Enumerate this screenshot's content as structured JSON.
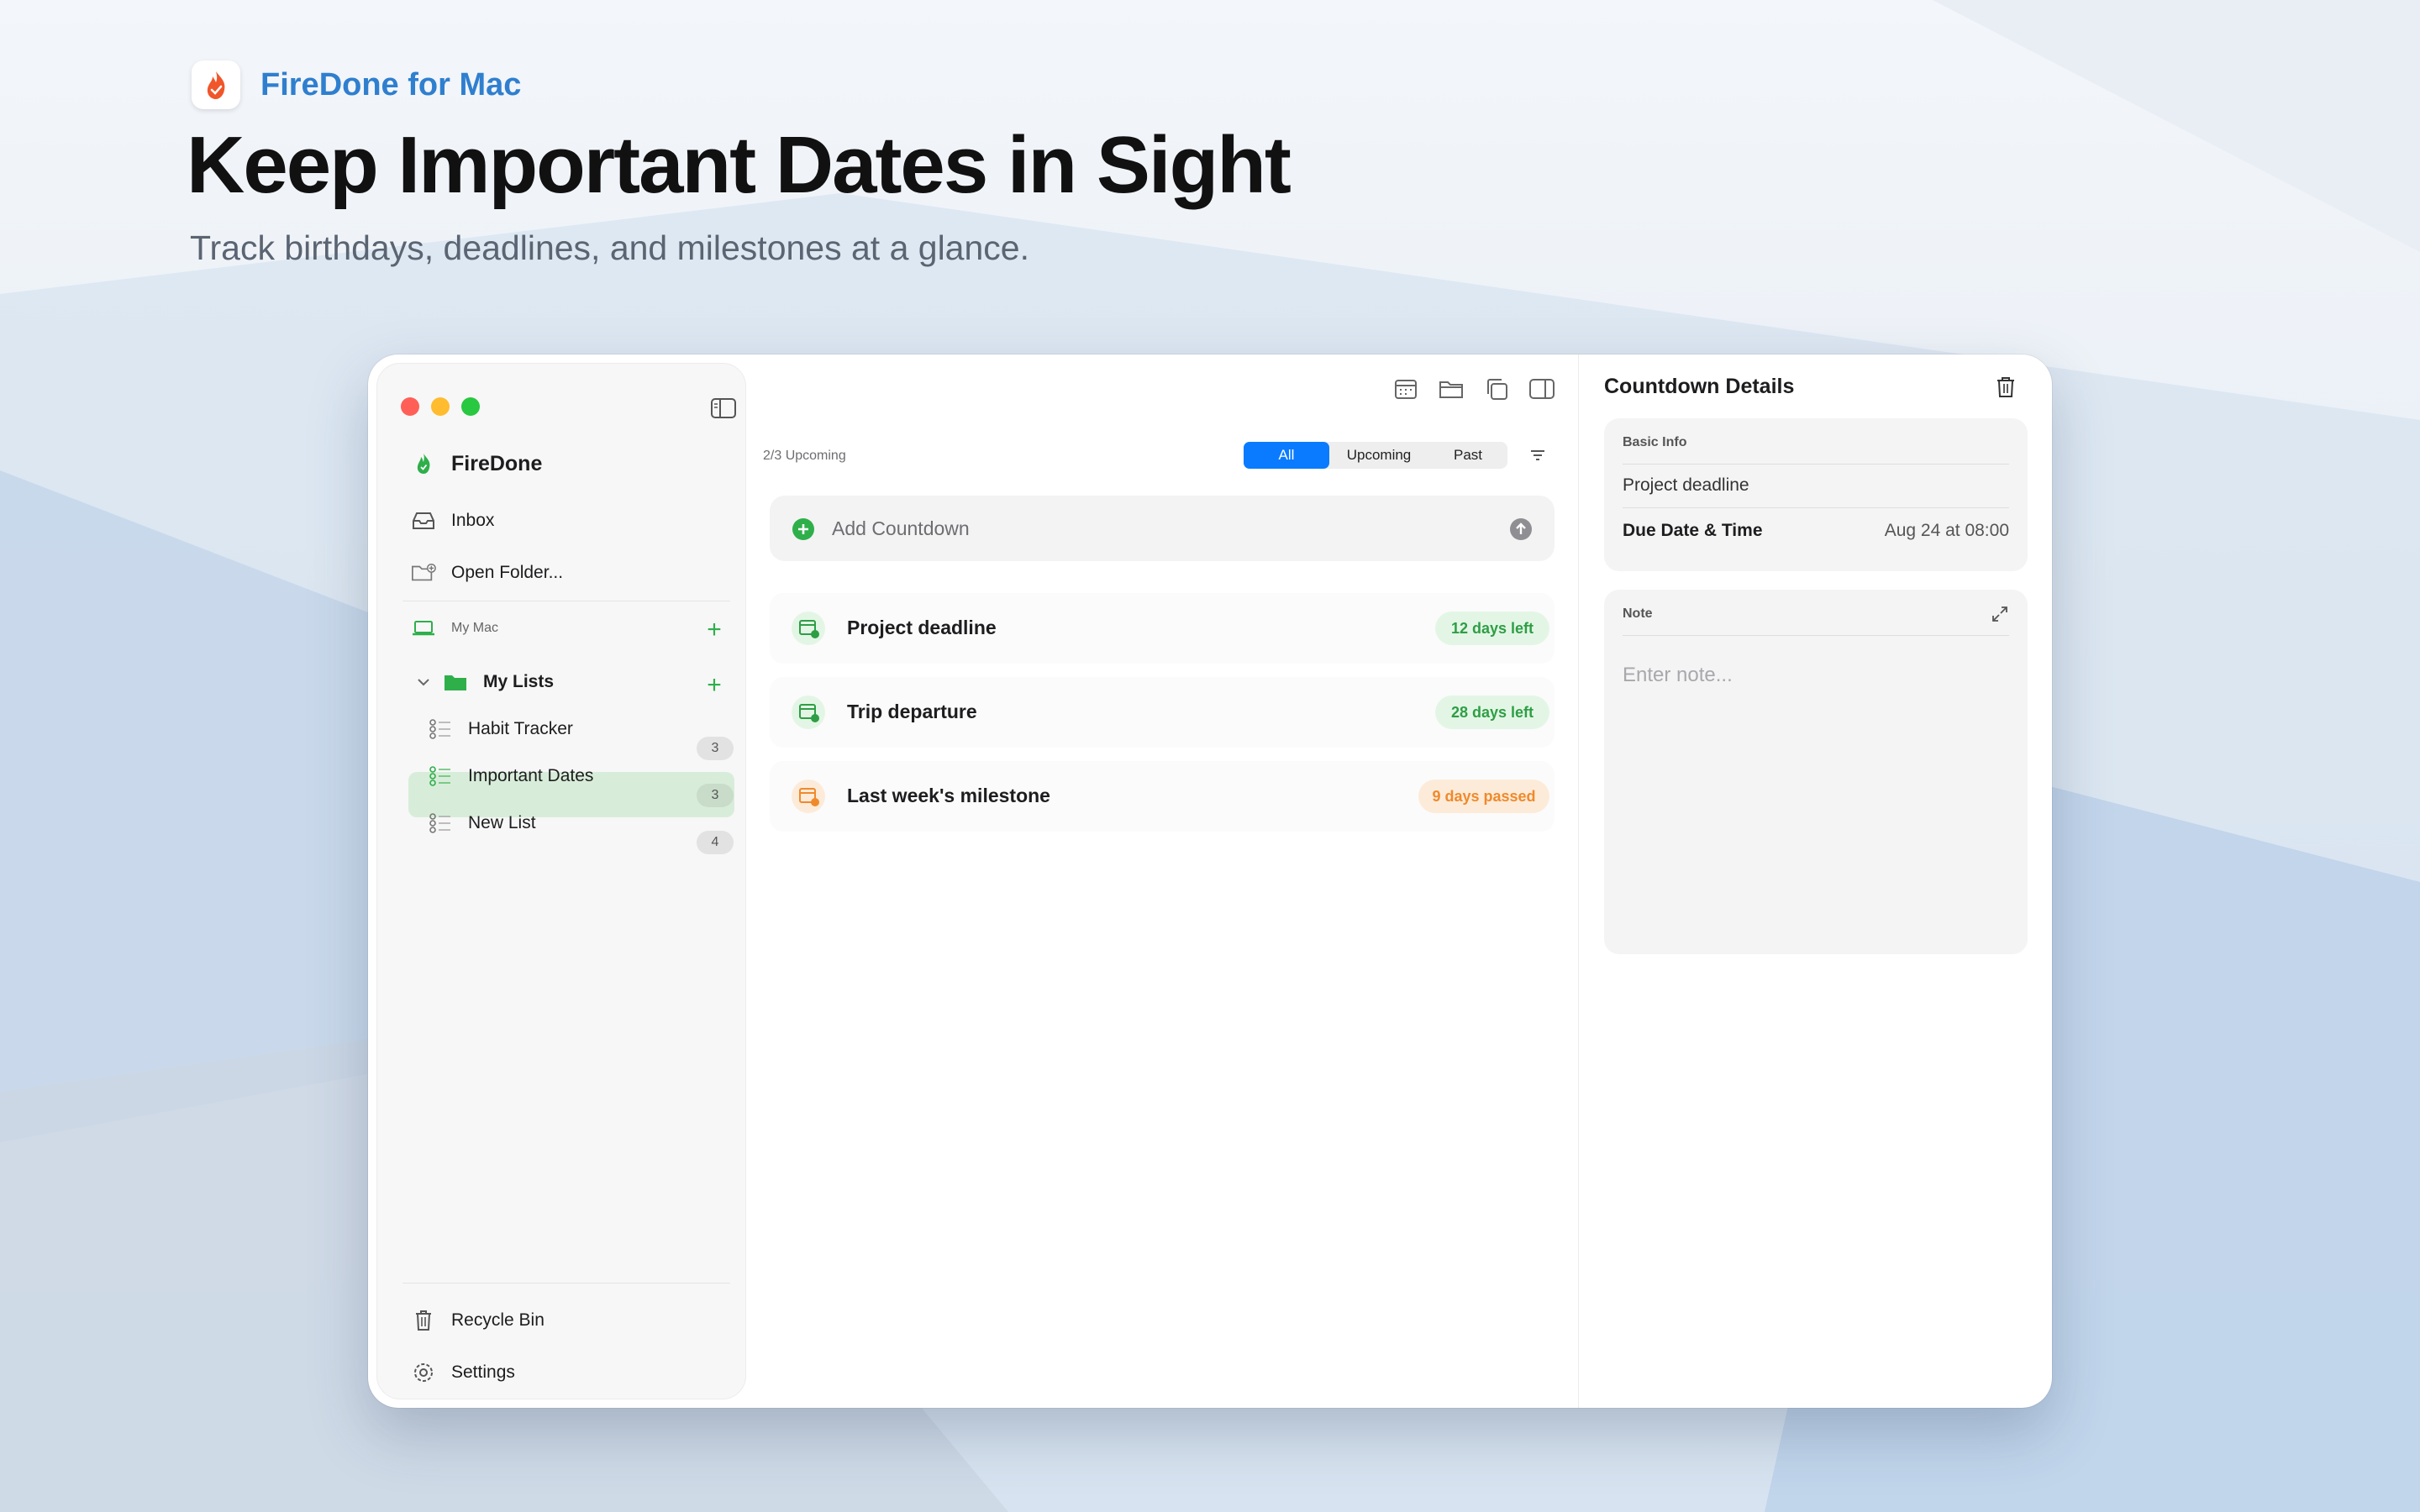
{
  "header": {
    "brand_name": "FireDone for Mac",
    "title": "Keep Important Dates in Sight",
    "subtitle": "Track birthdays, deadlines, and milestones at a glance."
  },
  "sidebar": {
    "app_name": "FireDone",
    "inbox": "Inbox",
    "open_folder": "Open Folder...",
    "section_my_mac": "My Mac",
    "group_my_lists": "My Lists",
    "lists": [
      {
        "label": "Habit Tracker",
        "count": "3"
      },
      {
        "label": "Important Dates",
        "count": "3"
      },
      {
        "label": "New List",
        "count": "4"
      }
    ],
    "recycle_bin": "Recycle Bin",
    "settings": "Settings"
  },
  "main": {
    "upcoming_summary": "2/3 Upcoming",
    "filters": [
      "All",
      "Upcoming",
      "Past"
    ],
    "selected_filter": "All",
    "add_placeholder": "Add Countdown",
    "items": [
      {
        "title": "Project deadline",
        "status": "12 days left",
        "tone": "green"
      },
      {
        "title": "Trip departure",
        "status": "28 days left",
        "tone": "green"
      },
      {
        "title": "Last week's milestone",
        "status": "9 days passed",
        "tone": "orange"
      }
    ]
  },
  "details": {
    "title": "Countdown Details",
    "basic_info_label": "Basic Info",
    "name_value": "Project deadline",
    "due_label": "Due Date & Time",
    "due_value": "Aug 24 at 08:00",
    "note_label": "Note",
    "note_placeholder": "Enter note..."
  },
  "colors": {
    "accent_blue": "#0a7bff",
    "brand_blue": "#2f7fcf",
    "green": "#2eaf4a",
    "orange": "#ef8a2c",
    "selection": "#d8edd9"
  },
  "icons": [
    "flame-icon",
    "sidebar-toggle-icon",
    "inbox-icon",
    "folder-add-icon",
    "laptop-icon",
    "plus-icon",
    "chevron-down-icon",
    "folder-icon",
    "list-icon",
    "trash-icon",
    "gear-icon",
    "calendar-icon",
    "folder-open-icon",
    "copy-icon",
    "panel-right-icon",
    "filter-icon",
    "arrow-up-icon",
    "expand-icon"
  ]
}
